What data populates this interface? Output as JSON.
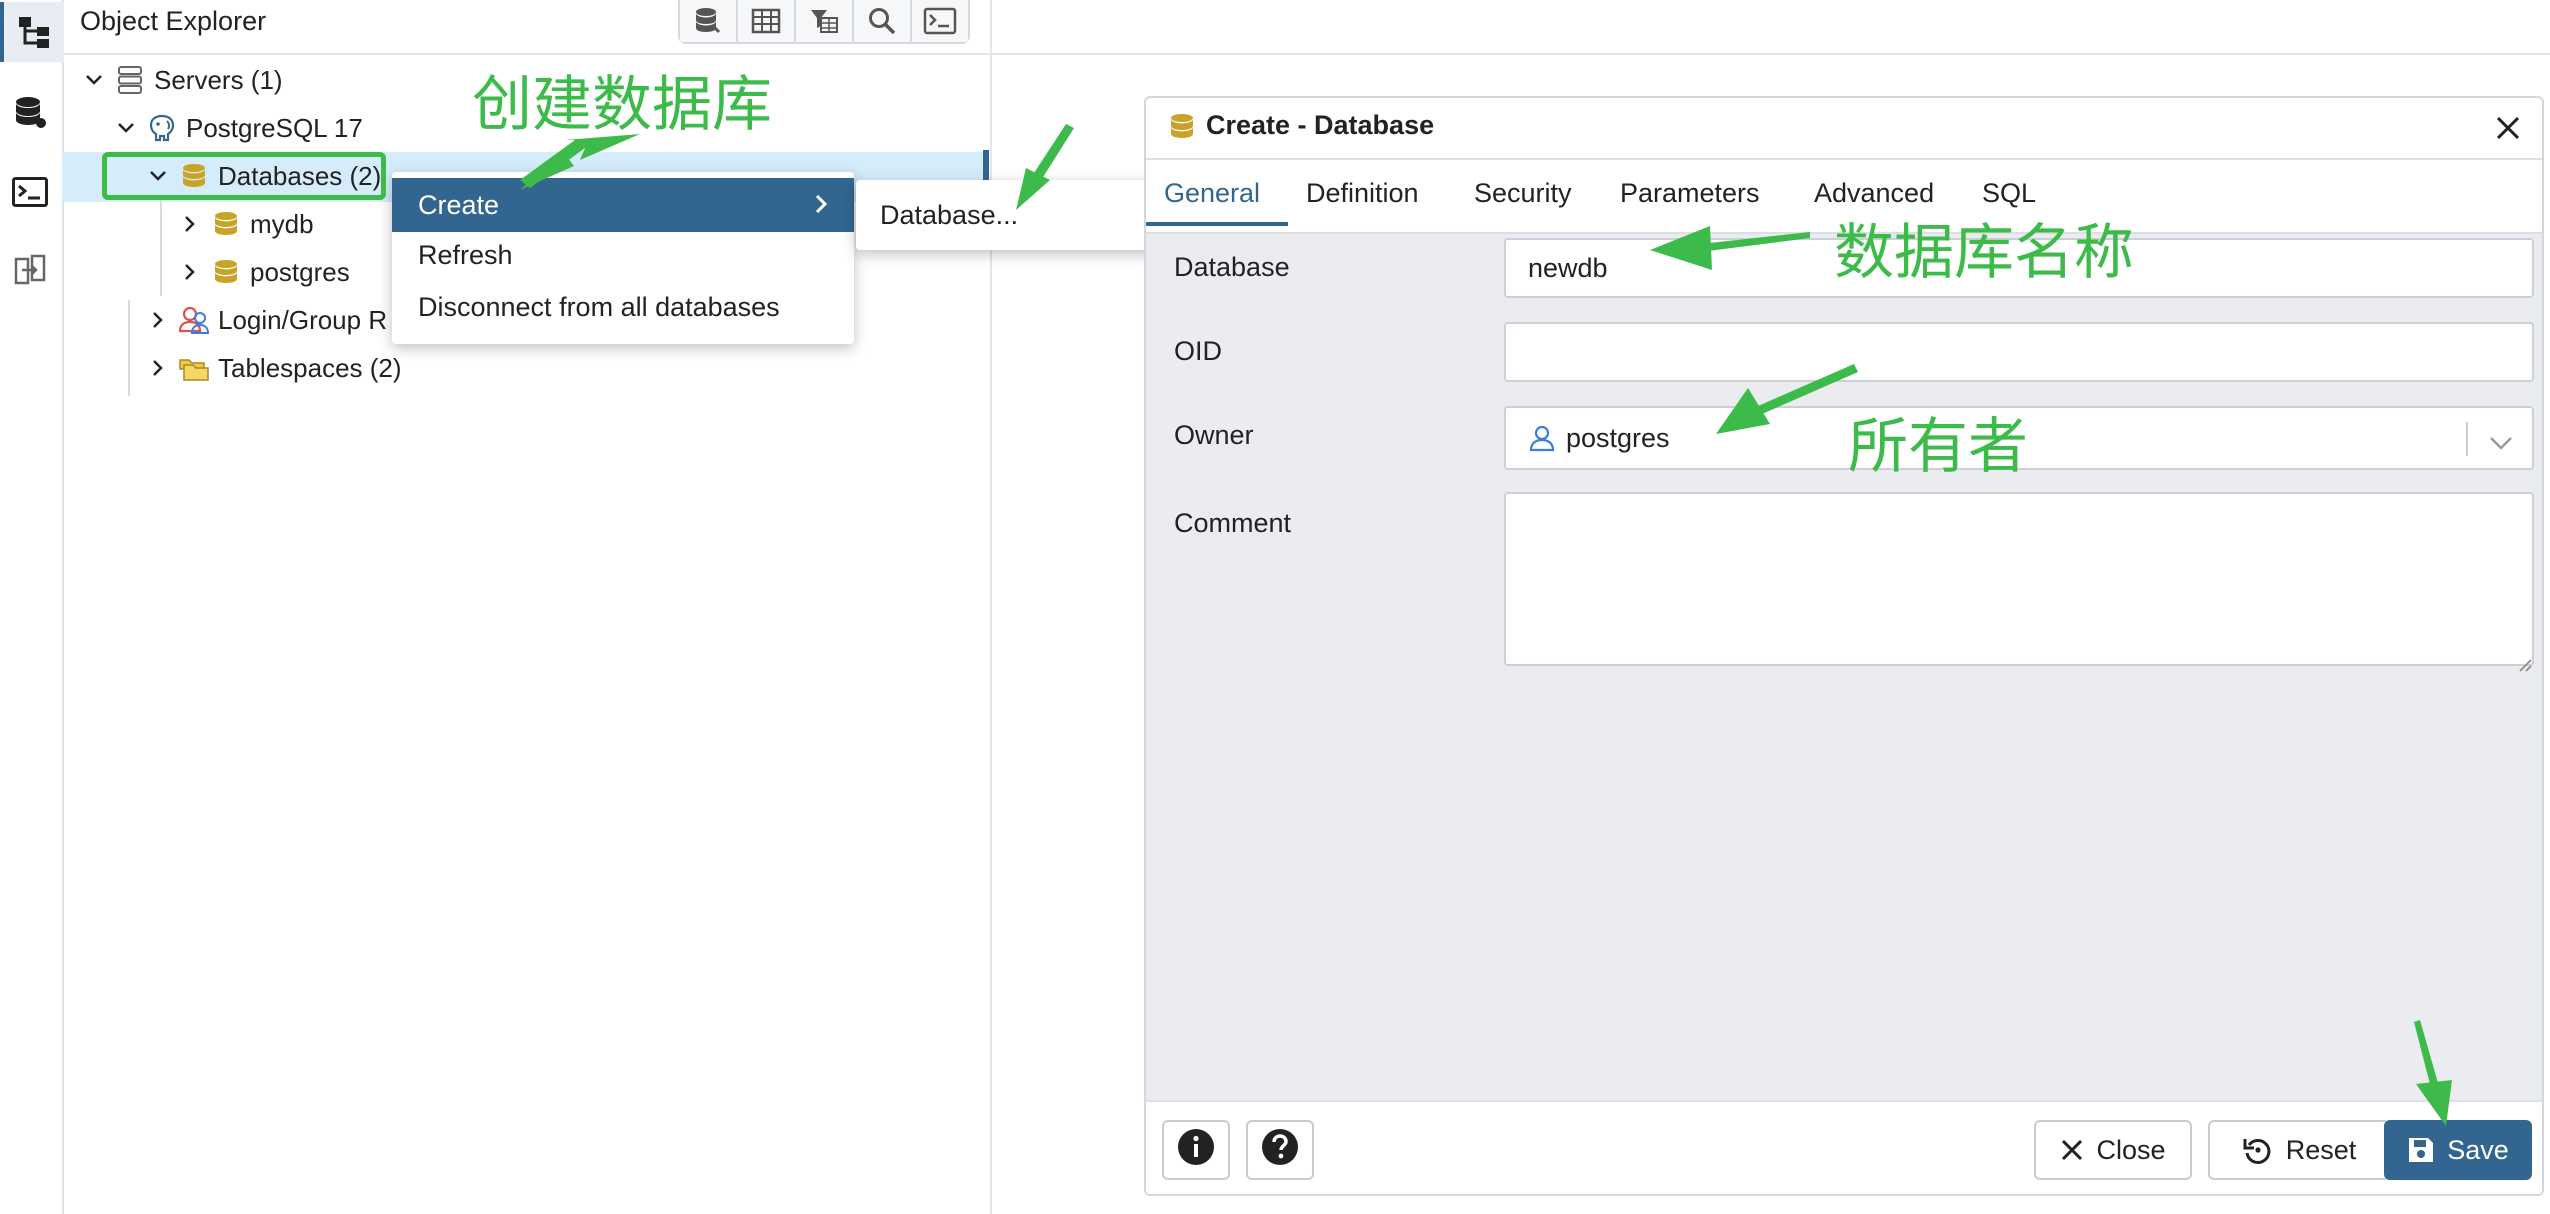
{
  "explorer": {
    "title": "Object Explorer",
    "toolbar": [
      "database-icon",
      "table-icon",
      "filter-table-icon",
      "search-icon",
      "terminal-icon"
    ],
    "tree": {
      "servers": "Servers (1)",
      "server": "PostgreSQL 17",
      "databases": "Databases (2)",
      "db1": "mydb",
      "db2": "postgres",
      "login_roles": "Login/Group R",
      "tablespaces": "Tablespaces (2)"
    }
  },
  "context_menu": {
    "items": [
      "Create",
      "Refresh",
      "Disconnect from all databases"
    ],
    "submenu_item": "Database..."
  },
  "dialog": {
    "title": "Create - Database",
    "tabs": [
      "General",
      "Definition",
      "Security",
      "Parameters",
      "Advanced",
      "SQL"
    ],
    "active_tab": "General",
    "fields": {
      "database_label": "Database",
      "database_value": "newdb",
      "oid_label": "OID",
      "oid_value": "",
      "owner_label": "Owner",
      "owner_value": "postgres",
      "comment_label": "Comment",
      "comment_value": ""
    },
    "buttons": {
      "close": "Close",
      "reset": "Reset",
      "save": "Save"
    }
  },
  "annotations": {
    "create_db": "创建数据库",
    "db_name": "数据库名称",
    "owner": "所有者"
  },
  "colors": {
    "accent": "#326690",
    "annotation": "#3dbb4a",
    "selection": "#d5ecfa",
    "db_icon": "#c9a227"
  }
}
